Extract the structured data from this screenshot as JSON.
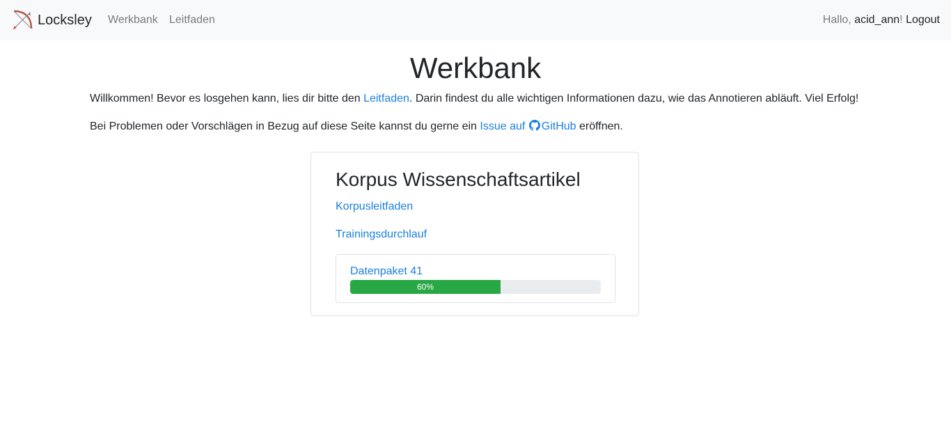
{
  "navbar": {
    "brand": "Locksley",
    "links": [
      "Werkbank",
      "Leitfaden"
    ],
    "greeting": "Hallo, ",
    "username": "acid_ann",
    "exclamation": "!",
    "logout": "Logout"
  },
  "page": {
    "title": "Werkbank",
    "intro1": {
      "before": "Willkommen! Bevor es losgehen kann, lies dir bitte den ",
      "link": "Leitfaden",
      "after": ". Darin findest du alle wichtigen Informationen dazu, wie das Annotieren abläuft. Viel Erfolg!"
    },
    "intro2": {
      "before": "Bei Problemen oder Vorschlägen in Bezug auf diese Seite kannst du gerne ein ",
      "link_issue": "Issue auf",
      "link_github": "GitHub",
      "after": " eröffnen."
    }
  },
  "corpus": {
    "title": "Korpus Wissenschaftsartikel",
    "links": [
      "Korpusleitfaden",
      "Trainingsdurchlauf"
    ],
    "package": {
      "title": "Datenpaket 41",
      "progress_label": "60%",
      "progress_value": 60
    }
  },
  "icons": {
    "brand_logo": "bow-and-arrow-icon",
    "github": "github-icon"
  },
  "colors": {
    "link": "#1a7fe0",
    "progress": "#28a745",
    "navbar_bg": "#f8f9fa"
  }
}
